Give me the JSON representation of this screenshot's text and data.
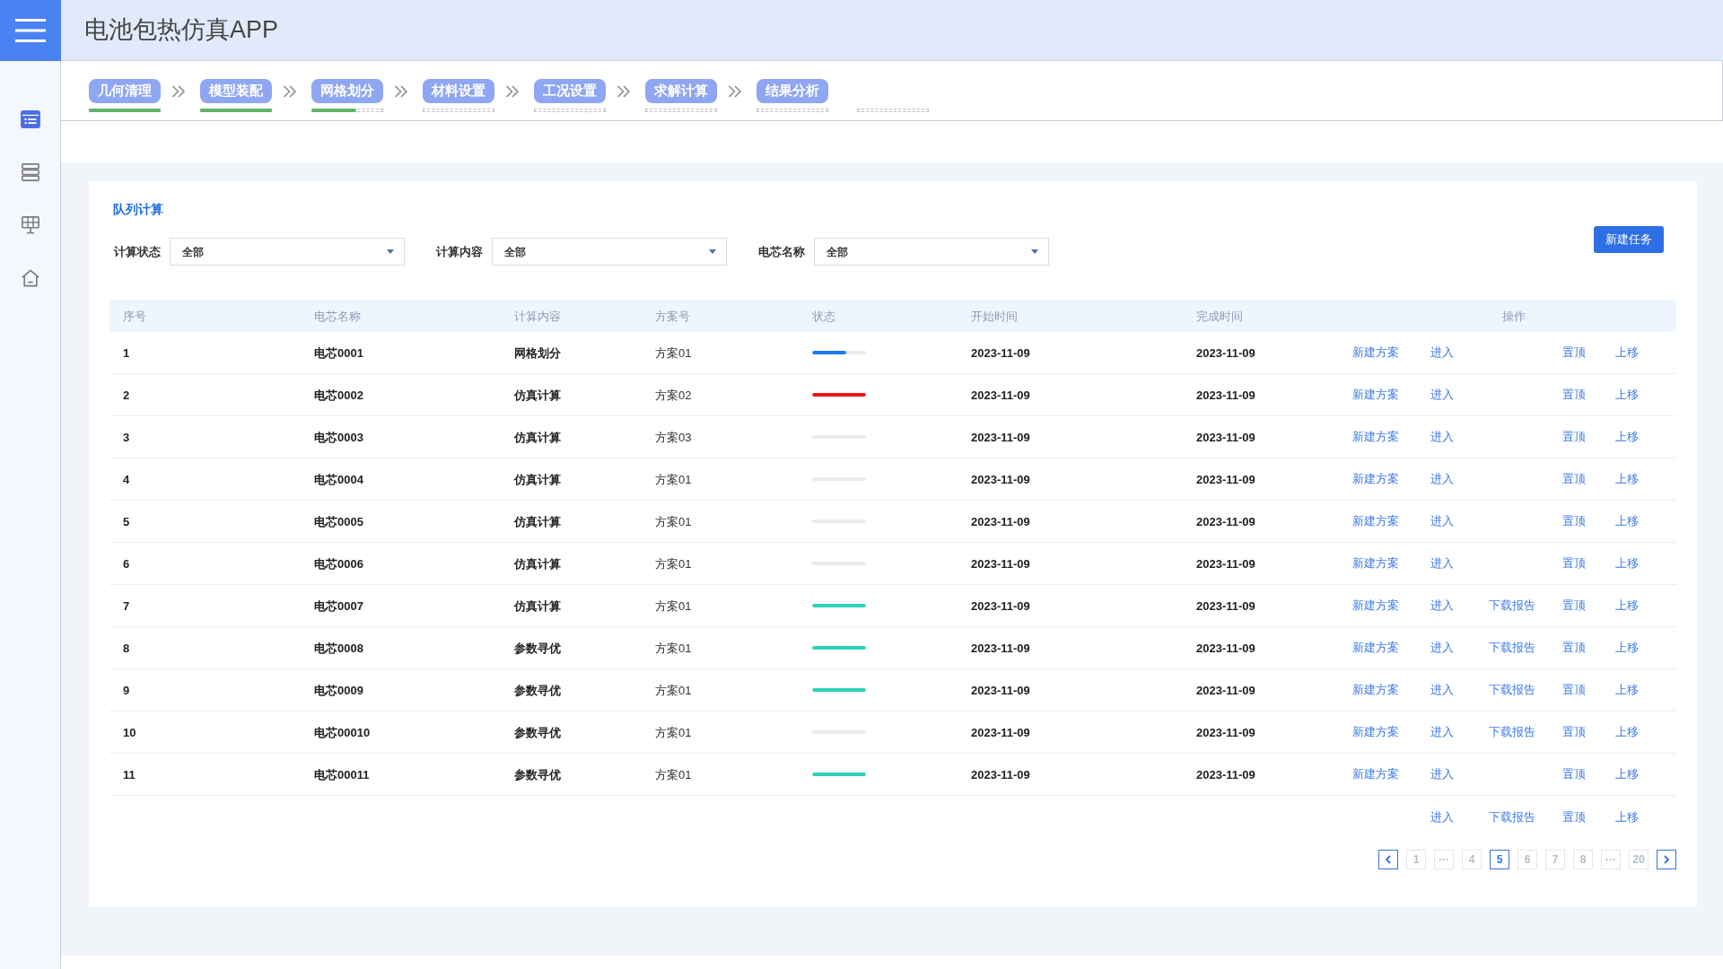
{
  "app": {
    "title": "电池包热仿真APP"
  },
  "sidebar": {
    "items": [
      {
        "kind": "list",
        "selected": true
      },
      {
        "kind": "rows",
        "selected": false
      },
      {
        "kind": "grid",
        "selected": false
      },
      {
        "kind": "home",
        "selected": false
      }
    ]
  },
  "steps": [
    {
      "label": "几何清理",
      "level": 1
    },
    {
      "label": "模型装配",
      "level": 1
    },
    {
      "label": "网格划分",
      "level": 0.62
    },
    {
      "label": "材料设置"
    },
    {
      "label": "工况设置"
    },
    {
      "label": "求解计算"
    },
    {
      "label": "结果分析"
    }
  ],
  "panel": {
    "title": "队列计算",
    "filters": [
      {
        "label": "计算状态",
        "value": "全部"
      },
      {
        "label": "计算内容",
        "value": "全部"
      },
      {
        "label": "电芯名称",
        "value": "全部"
      }
    ],
    "new_button": "新建任务"
  },
  "table": {
    "columns": [
      "序号",
      "电芯名称",
      "计算内容",
      "方案号",
      "状态",
      "开始时间",
      "完成时间",
      "操作"
    ],
    "rows": [
      {
        "index": "1",
        "name": "电芯0001",
        "content": "网格划分",
        "plan": "方案01",
        "status": {
          "level": 0.63,
          "color": "#1a7cf0"
        },
        "start": "2023-11-09",
        "end": "2023-11-09",
        "actions": [
          {
            "kind": "new_plan",
            "label": "新建方案"
          },
          {
            "kind": "enter",
            "label": "进入"
          },
          {
            "kind": "pin",
            "label": "置顶"
          },
          {
            "kind": "move_up",
            "label": "上移"
          }
        ]
      },
      {
        "index": "2",
        "name": "电芯0002",
        "content": "仿真计算",
        "plan": "方案02",
        "status": {
          "level": 1,
          "color": "#e8141c"
        },
        "start": "2023-11-09",
        "end": "2023-11-09",
        "actions": [
          {
            "kind": "new_plan",
            "label": "新建方案"
          },
          {
            "kind": "enter",
            "label": "进入"
          },
          {
            "kind": "pin",
            "label": "置顶"
          },
          {
            "kind": "move_up",
            "label": "上移"
          }
        ]
      },
      {
        "index": "3",
        "name": "电芯0003",
        "content": "仿真计算",
        "plan": "方案03",
        "start": "2023-11-09",
        "end": "2023-11-09",
        "actions": [
          {
            "kind": "new_plan",
            "label": "新建方案"
          },
          {
            "kind": "enter",
            "label": "进入"
          },
          {
            "kind": "pin",
            "label": "置顶"
          },
          {
            "kind": "move_up",
            "label": "上移"
          }
        ]
      },
      {
        "index": "4",
        "name": "电芯0004",
        "content": "仿真计算",
        "plan": "方案01",
        "start": "2023-11-09",
        "end": "2023-11-09",
        "actions": [
          {
            "kind": "new_plan",
            "label": "新建方案"
          },
          {
            "kind": "enter",
            "label": "进入"
          },
          {
            "kind": "pin",
            "label": "置顶"
          },
          {
            "kind": "move_up",
            "label": "上移"
          }
        ]
      },
      {
        "index": "5",
        "name": "电芯0005",
        "content": "仿真计算",
        "plan": "方案01",
        "start": "2023-11-09",
        "end": "2023-11-09",
        "actions": [
          {
            "kind": "new_plan",
            "label": "新建方案"
          },
          {
            "kind": "enter",
            "label": "进入"
          },
          {
            "kind": "pin",
            "label": "置顶"
          },
          {
            "kind": "move_up",
            "label": "上移"
          }
        ]
      },
      {
        "index": "6",
        "name": "电芯0006",
        "content": "仿真计算",
        "plan": "方案01",
        "start": "2023-11-09",
        "end": "2023-11-09",
        "actions": [
          {
            "kind": "new_plan",
            "label": "新建方案"
          },
          {
            "kind": "enter",
            "label": "进入"
          },
          {
            "kind": "pin",
            "label": "置顶"
          },
          {
            "kind": "move_up",
            "label": "上移"
          }
        ]
      },
      {
        "index": "7",
        "name": "电芯0007",
        "content": "仿真计算",
        "plan": "方案01",
        "status": {
          "level": 1,
          "color": "#2dd3b8"
        },
        "start": "2023-11-09",
        "end": "2023-11-09",
        "actions": [
          {
            "kind": "new_plan",
            "label": "新建方案"
          },
          {
            "kind": "enter",
            "label": "进入"
          },
          {
            "kind": "download",
            "label": "下载报告"
          },
          {
            "kind": "pin",
            "label": "置顶"
          },
          {
            "kind": "move_up",
            "label": "上移"
          }
        ]
      },
      {
        "index": "8",
        "name": "电芯0008",
        "content": "参数寻优",
        "plan": "方案01",
        "status": {
          "level": 1,
          "color": "#2dd3b8"
        },
        "start": "2023-11-09",
        "end": "2023-11-09",
        "actions": [
          {
            "kind": "new_plan",
            "label": "新建方案"
          },
          {
            "kind": "enter",
            "label": "进入"
          },
          {
            "kind": "download",
            "label": "下载报告"
          },
          {
            "kind": "pin",
            "label": "置顶"
          },
          {
            "kind": "move_up",
            "label": "上移"
          }
        ]
      },
      {
        "index": "9",
        "name": "电芯0009",
        "content": "参数寻优",
        "plan": "方案01",
        "status": {
          "level": 1,
          "color": "#2dd3b8"
        },
        "start": "2023-11-09",
        "end": "2023-11-09",
        "actions": [
          {
            "kind": "new_plan",
            "label": "新建方案"
          },
          {
            "kind": "enter",
            "label": "进入"
          },
          {
            "kind": "download",
            "label": "下载报告"
          },
          {
            "kind": "pin",
            "label": "置顶"
          },
          {
            "kind": "move_up",
            "label": "上移"
          }
        ]
      },
      {
        "index": "10",
        "name": "电芯00010",
        "content": "参数寻优",
        "plan": "方案01",
        "start": "2023-11-09",
        "end": "2023-11-09",
        "actions": [
          {
            "kind": "new_plan",
            "label": "新建方案"
          },
          {
            "kind": "enter",
            "label": "进入"
          },
          {
            "kind": "download",
            "label": "下载报告"
          },
          {
            "kind": "pin",
            "label": "置顶"
          },
          {
            "kind": "move_up",
            "label": "上移"
          }
        ]
      },
      {
        "index": "11",
        "name": "电芯00011",
        "content": "参数寻优",
        "plan": "方案01",
        "status": {
          "level": 1,
          "color": "#2dd3b8"
        },
        "start": "2023-11-09",
        "end": "2023-11-09",
        "actions": [
          {
            "kind": "new_plan",
            "label": "新建方案"
          },
          {
            "kind": "enter",
            "label": "进入"
          },
          {
            "kind": "pin",
            "label": "置顶"
          },
          {
            "kind": "move_up",
            "label": "上移"
          }
        ]
      }
    ],
    "trailing_actions": [
      {
        "kind": "enter",
        "label": "进入"
      },
      {
        "kind": "download",
        "label": "下载报告"
      },
      {
        "kind": "pin",
        "label": "置顶"
      },
      {
        "kind": "move_up",
        "label": "上移"
      }
    ]
  },
  "pagination": {
    "pages": [
      {
        "label": "1",
        "selected": false
      },
      {
        "label": "···",
        "selected": false
      },
      {
        "label": "4",
        "selected": false
      },
      {
        "label": "5",
        "selected": true
      },
      {
        "label": "6",
        "selected": false
      },
      {
        "label": "7",
        "selected": false
      },
      {
        "label": "8",
        "selected": false
      },
      {
        "label": "···",
        "selected": false
      },
      {
        "label": "20",
        "selected": false
      }
    ]
  }
}
